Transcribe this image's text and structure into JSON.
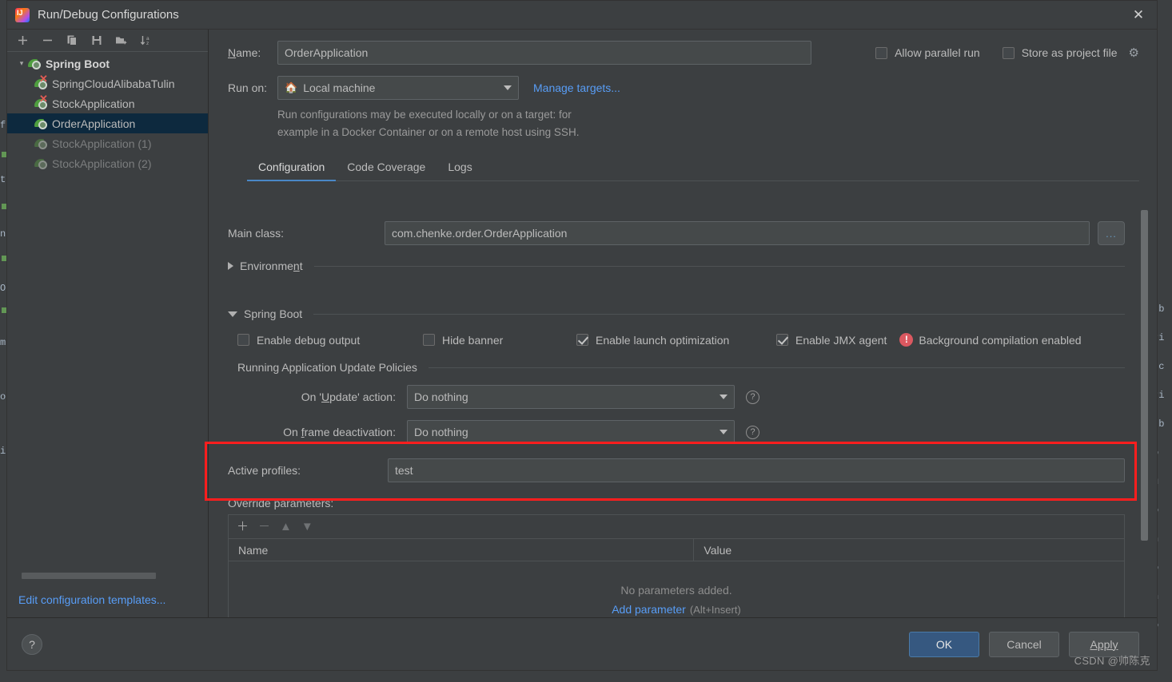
{
  "window": {
    "title": "Run/Debug Configurations",
    "app_icon": "intellij-idea-logo",
    "close_icon": "✕"
  },
  "left_pane": {
    "toolbar": [
      {
        "name": "add",
        "icon": "plus-icon"
      },
      {
        "name": "remove",
        "icon": "minus-icon"
      },
      {
        "name": "copy",
        "icon": "copy-icon"
      },
      {
        "name": "save",
        "icon": "save-icon"
      },
      {
        "name": "new-folder",
        "icon": "folder-add-icon"
      },
      {
        "name": "sort",
        "icon": "sort-alphabetical-icon"
      }
    ],
    "tree": [
      {
        "label": "Spring Boot",
        "type": "group",
        "expanded": true,
        "arrow": "⌄"
      },
      {
        "label": "SpringCloudAlibabaTulin",
        "type": "item",
        "error": true
      },
      {
        "label": "StockApplication",
        "type": "item",
        "error": true
      },
      {
        "label": "OrderApplication",
        "type": "item",
        "selected": true
      },
      {
        "label": "StockApplication (1)",
        "type": "item",
        "dim": true
      },
      {
        "label": "StockApplication (2)",
        "type": "item",
        "dim": true
      }
    ],
    "footer_link": "Edit configuration templates..."
  },
  "form": {
    "name_label": "Name:",
    "name_value": "OrderApplication",
    "run_on_label": "Run on:",
    "run_on_value": "Local machine",
    "run_on_icon": "home-icon",
    "manage_targets_link": "Manage targets...",
    "hint_line1": "Run configurations may be executed locally or on a target: for",
    "hint_line2": "example in a Docker Container or on a remote host using SSH.",
    "allow_parallel_run": {
      "label": "Allow parallel run",
      "checked": false
    },
    "store_as_project_file": {
      "label": "Store as project file",
      "checked": false,
      "gear_icon": "gear-icon"
    }
  },
  "tabs": [
    {
      "label": "Configuration",
      "active": true
    },
    {
      "label": "Code Coverage",
      "active": false
    },
    {
      "label": "Logs",
      "active": false
    }
  ],
  "configuration": {
    "main_class_label": "Main class:",
    "main_class_value": "com.chenke.order.OrderApplication",
    "browse_button": "...",
    "environment_section": "Environment",
    "spring_boot_section": "Spring Boot",
    "spring_checks": [
      {
        "label": "Enable debug output",
        "checked": false,
        "underline": "d"
      },
      {
        "label": "Hide banner",
        "checked": false,
        "underline": "H"
      },
      {
        "label": "Enable launch optimization",
        "checked": true,
        "underline": "z"
      },
      {
        "label": "Enable JMX agent",
        "checked": true,
        "underline": "X"
      }
    ],
    "background_warning": {
      "icon": "error-circle-icon",
      "text": "Background compilation enabled"
    },
    "update_policies_title": "Running Application Update Policies",
    "on_update_label": "On 'Update' action:",
    "on_update_value": "Do nothing",
    "on_frame_deactivation_label": "On frame deactivation:",
    "on_frame_deactivation_value": "Do nothing",
    "help_icon": "question-circle-icon",
    "active_profiles_label": "Active profiles:",
    "active_profiles_value": "test",
    "override_parameters_label": "Override parameters:",
    "param_toolbar": [
      {
        "name": "add-parameter",
        "icon": "plus-icon",
        "enabled": true
      },
      {
        "name": "remove-parameter",
        "icon": "minus-icon",
        "enabled": false
      },
      {
        "name": "move-up",
        "icon": "arrow-up-icon",
        "enabled": false
      },
      {
        "name": "move-down",
        "icon": "arrow-down-icon",
        "enabled": false
      }
    ],
    "param_columns": [
      "Name",
      "Value"
    ],
    "param_empty_text": "No parameters added.",
    "param_add_link": "Add parameter",
    "param_add_hint": "(Alt+Insert)"
  },
  "footer": {
    "help_icon": "?",
    "ok_label": "OK",
    "cancel_label": "Cancel",
    "apply_label": "Apply"
  },
  "watermark": "CSDN @帅陈克",
  "colors": {
    "dialog_bg": "#3c3f41",
    "input_bg": "#45494a",
    "selection_bg": "#0d293e",
    "accent_link": "#589df6",
    "tab_underline": "#4a88c7",
    "primary_button": "#365880",
    "annotation_red": "#ff1e1e",
    "error_red": "#db5860",
    "spring_green": "#4f9e3f"
  },
  "background_editor": {
    "left_fragments": [
      "fi",
      "tr",
      "n",
      "Or",
      "m",
      "o",
      "in"
    ],
    "right_fragments": [
      ".b",
      "ri",
      ".c",
      "ri",
      ".b",
      "o",
      "u",
      "o",
      "n",
      "o",
      "n",
      "o"
    ]
  }
}
